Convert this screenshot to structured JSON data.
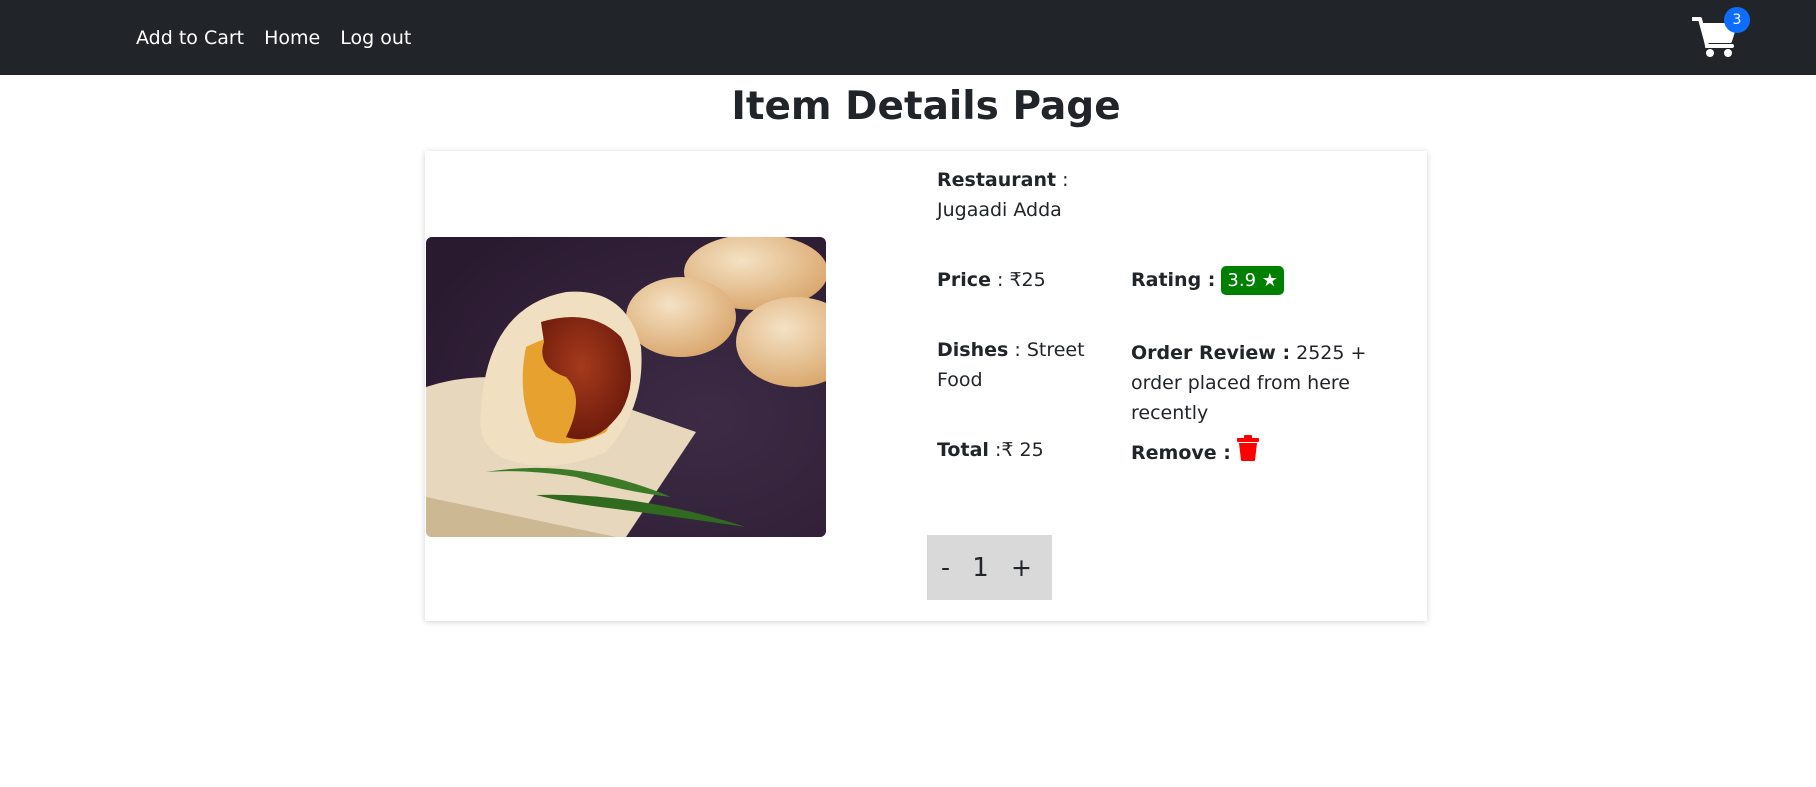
{
  "nav": {
    "links": [
      "Add to Cart",
      "Home",
      "Log out"
    ],
    "cart_count": "3"
  },
  "page": {
    "title": "Item Details Page"
  },
  "item": {
    "restaurant_label": "Restaurant",
    "restaurant_value": "Jugaadi Adda",
    "price_label": "Price",
    "price_value": "₹25",
    "rating_label": "Rating :",
    "rating_value": "3.9 ★",
    "dishes_label": "Dishes",
    "dishes_value": "Street Food",
    "review_label": "Order Review :",
    "review_value": "2525 + order placed from here recently",
    "total_label": "Total",
    "total_value": "₹ 25",
    "remove_label": "Remove :",
    "quantity": "1",
    "minus": "-",
    "plus": "+"
  },
  "colors": {
    "navbar": "#212529",
    "badge": "#0d6efd",
    "rating": "#008000",
    "trash": "#ff0000",
    "stepper": "#d9d9d9"
  },
  "icons": {
    "cart": "shopping-cart-icon",
    "remove": "trash-icon"
  }
}
